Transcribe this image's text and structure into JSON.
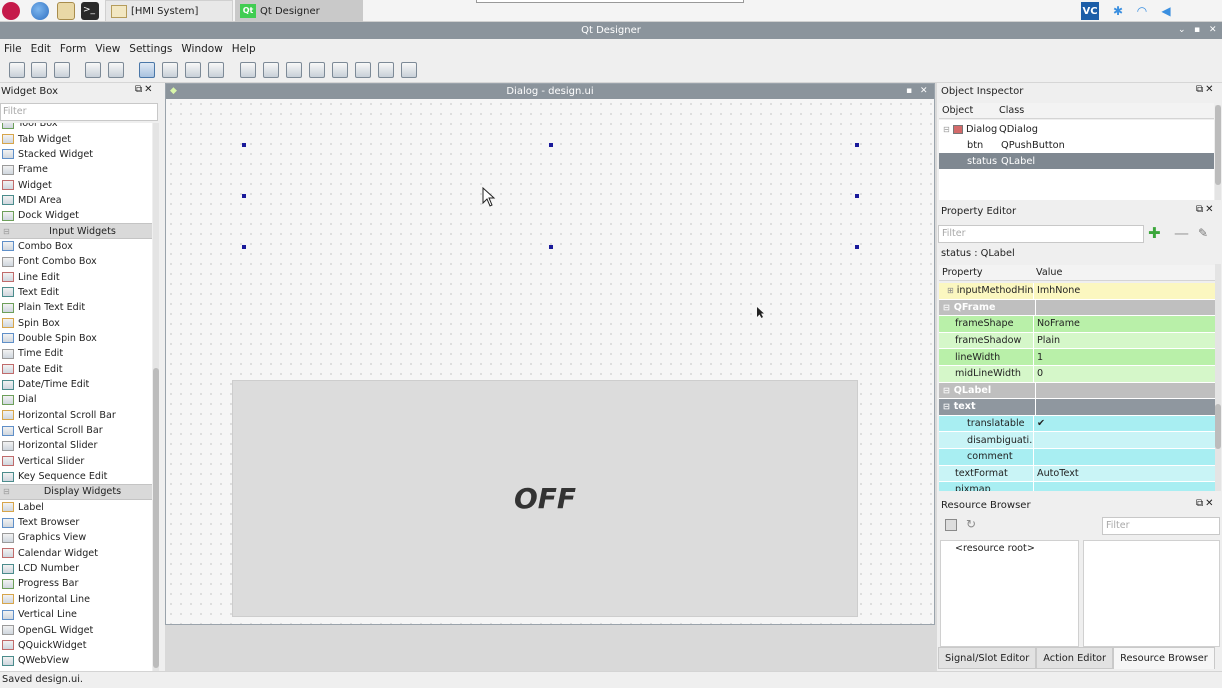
{
  "taskbar": {
    "tasks": [
      {
        "label": "[HMI System]",
        "active": false
      },
      {
        "label": "Qt Designer",
        "active": true
      }
    ],
    "tray_badge": "VC"
  },
  "window": {
    "title": "Qt Designer"
  },
  "menubar": {
    "items": [
      "File",
      "Edit",
      "Form",
      "View",
      "Settings",
      "Window",
      "Help"
    ]
  },
  "widget_box": {
    "title": "Widget Box",
    "filter_placeholder": "Filter",
    "items": [
      {
        "label": "Tool Box",
        "type": "item",
        "icon": "toolbox-icon"
      },
      {
        "label": "Tab Widget",
        "type": "item",
        "icon": "tab-widget-icon"
      },
      {
        "label": "Stacked Widget",
        "type": "item",
        "icon": "stacked-widget-icon"
      },
      {
        "label": "Frame",
        "type": "item",
        "icon": "frame-icon"
      },
      {
        "label": "Widget",
        "type": "item",
        "icon": "widget-icon"
      },
      {
        "label": "MDI Area",
        "type": "item",
        "icon": "mdi-area-icon"
      },
      {
        "label": "Dock Widget",
        "type": "item",
        "icon": "dock-widget-icon"
      },
      {
        "label": "Input Widgets",
        "type": "category"
      },
      {
        "label": "Combo Box",
        "type": "item",
        "icon": "combo-box-icon"
      },
      {
        "label": "Font Combo Box",
        "type": "item",
        "icon": "font-combo-box-icon"
      },
      {
        "label": "Line Edit",
        "type": "item",
        "icon": "line-edit-icon"
      },
      {
        "label": "Text Edit",
        "type": "item",
        "icon": "text-edit-icon"
      },
      {
        "label": "Plain Text Edit",
        "type": "item",
        "icon": "plain-text-edit-icon"
      },
      {
        "label": "Spin Box",
        "type": "item",
        "icon": "spin-box-icon"
      },
      {
        "label": "Double Spin Box",
        "type": "item",
        "icon": "double-spin-box-icon"
      },
      {
        "label": "Time Edit",
        "type": "item",
        "icon": "time-edit-icon"
      },
      {
        "label": "Date Edit",
        "type": "item",
        "icon": "date-edit-icon"
      },
      {
        "label": "Date/Time Edit",
        "type": "item",
        "icon": "datetime-edit-icon"
      },
      {
        "label": "Dial",
        "type": "item",
        "icon": "dial-icon"
      },
      {
        "label": "Horizontal Scroll Bar",
        "type": "item",
        "icon": "horizontal-scrollbar-icon"
      },
      {
        "label": "Vertical Scroll Bar",
        "type": "item",
        "icon": "vertical-scrollbar-icon"
      },
      {
        "label": "Horizontal Slider",
        "type": "item",
        "icon": "horizontal-slider-icon"
      },
      {
        "label": "Vertical Slider",
        "type": "item",
        "icon": "vertical-slider-icon"
      },
      {
        "label": "Key Sequence Edit",
        "type": "item",
        "icon": "key-sequence-edit-icon"
      },
      {
        "label": "Display Widgets",
        "type": "category"
      },
      {
        "label": "Label",
        "type": "item",
        "icon": "label-icon"
      },
      {
        "label": "Text Browser",
        "type": "item",
        "icon": "text-browser-icon"
      },
      {
        "label": "Graphics View",
        "type": "item",
        "icon": "graphics-view-icon"
      },
      {
        "label": "Calendar Widget",
        "type": "item",
        "icon": "calendar-widget-icon"
      },
      {
        "label": "LCD Number",
        "type": "item",
        "icon": "lcd-number-icon"
      },
      {
        "label": "Progress Bar",
        "type": "item",
        "icon": "progress-bar-icon"
      },
      {
        "label": "Horizontal Line",
        "type": "item",
        "icon": "horizontal-line-icon"
      },
      {
        "label": "Vertical Line",
        "type": "item",
        "icon": "vertical-line-icon"
      },
      {
        "label": "OpenGL Widget",
        "type": "item",
        "icon": "opengl-widget-icon"
      },
      {
        "label": "QQuickWidget",
        "type": "item",
        "icon": "qquickwidget-icon"
      },
      {
        "label": "QWebView",
        "type": "item",
        "icon": "qwebview-icon"
      }
    ]
  },
  "form_window": {
    "title": "Dialog - design.ui",
    "status_label_text": "OFF"
  },
  "object_inspector": {
    "title": "Object Inspector",
    "columns": [
      "Object",
      "Class"
    ],
    "rows": [
      {
        "object": "Dialog",
        "class": "QDialog",
        "level": 0,
        "selected": false
      },
      {
        "object": "btn",
        "class": "QPushButton",
        "level": 1,
        "selected": false
      },
      {
        "object": "status",
        "class": "QLabel",
        "level": 1,
        "selected": true
      }
    ]
  },
  "property_editor": {
    "title": "Property Editor",
    "filter_placeholder": "Filter",
    "object_caption": "status : QLabel",
    "columns": [
      "Property",
      "Value"
    ],
    "rows": [
      {
        "name": "inputMethodHin...",
        "value": "ImhNone",
        "style": "yellow",
        "indent": 1,
        "expand": true
      },
      {
        "name": "QFrame",
        "value": "",
        "style": "group",
        "indent": 0
      },
      {
        "name": "frameShape",
        "value": "NoFrame",
        "style": "green",
        "indent": 1
      },
      {
        "name": "frameShadow",
        "value": "Plain",
        "style": "green2",
        "indent": 1
      },
      {
        "name": "lineWidth",
        "value": "1",
        "style": "green",
        "indent": 1
      },
      {
        "name": "midLineWidth",
        "value": "0",
        "style": "green2",
        "indent": 1
      },
      {
        "name": "QLabel",
        "value": "",
        "style": "group",
        "indent": 0
      },
      {
        "name": "text",
        "value": "",
        "style": "subgroup",
        "indent": 0
      },
      {
        "name": "translatable",
        "value": "✔",
        "style": "cyan",
        "indent": 2
      },
      {
        "name": "disambiguati...",
        "value": "",
        "style": "cyan2",
        "indent": 2
      },
      {
        "name": "comment",
        "value": "",
        "style": "cyan",
        "indent": 2
      },
      {
        "name": "textFormat",
        "value": "AutoText",
        "style": "cyan2",
        "indent": 1
      },
      {
        "name": "pixmap",
        "value": "",
        "style": "cyan",
        "indent": 1
      }
    ]
  },
  "resource_browser": {
    "title": "Resource Browser",
    "filter_placeholder": "Filter",
    "root_item": "<resource root>"
  },
  "bottom_tabs": [
    {
      "label": "Signal/Slot Editor",
      "active": false
    },
    {
      "label": "Action Editor",
      "active": false
    },
    {
      "label": "Resource Browser",
      "active": true
    }
  ],
  "statusbar": {
    "message": "Saved design.ui."
  },
  "colors": {
    "titlebar": "#8b949c",
    "selection": "#7f8891",
    "group_row": "#bfbfbf",
    "green_row": "#b9f0a9",
    "cyan_row": "#a8eef2",
    "yellow_row": "#fbf7c0",
    "accent_plus": "#3aa63a"
  }
}
